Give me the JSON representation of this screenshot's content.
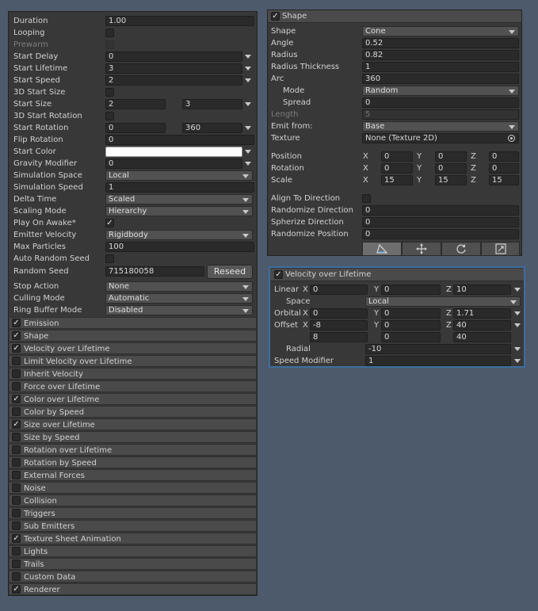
{
  "main": {
    "duration": {
      "label": "Duration",
      "value": "1.00"
    },
    "looping": {
      "label": "Looping"
    },
    "prewarm": {
      "label": "Prewarm"
    },
    "start_delay": {
      "label": "Start Delay",
      "value": "0"
    },
    "start_lifetime": {
      "label": "Start Lifetime",
      "value": "3"
    },
    "start_speed": {
      "label": "Start Speed",
      "value": "2"
    },
    "start_size_3d": {
      "label": "3D Start Size"
    },
    "start_size": {
      "label": "Start Size",
      "min": "2",
      "max": "3"
    },
    "start_rotation_3d": {
      "label": "3D Start Rotation"
    },
    "start_rotation": {
      "label": "Start Rotation",
      "min": "0",
      "max": "360"
    },
    "flip_rotation": {
      "label": "Flip Rotation",
      "value": "0"
    },
    "start_color": {
      "label": "Start Color",
      "color": "#ffffff"
    },
    "gravity_modifier": {
      "label": "Gravity Modifier",
      "value": "0"
    },
    "simulation_space": {
      "label": "Simulation Space",
      "value": "Local"
    },
    "simulation_speed": {
      "label": "Simulation Speed",
      "value": "1"
    },
    "delta_time": {
      "label": "Delta Time",
      "value": "Scaled"
    },
    "scaling_mode": {
      "label": "Scaling Mode",
      "value": "Hierarchy"
    },
    "play_on_awake": {
      "label": "Play On Awake*",
      "checked": "✓"
    },
    "emitter_velocity": {
      "label": "Emitter Velocity",
      "value": "Rigidbody"
    },
    "max_particles": {
      "label": "Max Particles",
      "value": "100"
    },
    "auto_random_seed": {
      "label": "Auto Random Seed"
    },
    "random_seed": {
      "label": "Random Seed",
      "value": "715180058",
      "button": "Reseed"
    },
    "stop_action": {
      "label": "Stop Action",
      "value": "None"
    },
    "culling_mode": {
      "label": "Culling Mode",
      "value": "Automatic"
    },
    "ring_buffer_mode": {
      "label": "Ring Buffer Mode",
      "value": "Disabled"
    }
  },
  "modules": [
    {
      "label": "Emission",
      "check": "✓"
    },
    {
      "label": "Shape",
      "check": "✓"
    },
    {
      "label": "Velocity over Lifetime",
      "check": "✓"
    },
    {
      "label": "Limit Velocity over Lifetime",
      "check": ""
    },
    {
      "label": "Inherit Velocity",
      "check": ""
    },
    {
      "label": "Force over Lifetime",
      "check": ""
    },
    {
      "label": "Color over Lifetime",
      "check": "✓"
    },
    {
      "label": "Color by Speed",
      "check": ""
    },
    {
      "label": "Size over Lifetime",
      "check": "✓"
    },
    {
      "label": "Size by Speed",
      "check": ""
    },
    {
      "label": "Rotation over Lifetime",
      "check": ""
    },
    {
      "label": "Rotation by Speed",
      "check": ""
    },
    {
      "label": "External Forces",
      "check": ""
    },
    {
      "label": "Noise",
      "check": ""
    },
    {
      "label": "Collision",
      "check": ""
    },
    {
      "label": "Triggers",
      "check": ""
    },
    {
      "label": "Sub Emitters",
      "check": ""
    },
    {
      "label": "Texture Sheet Animation",
      "check": "✓"
    },
    {
      "label": "Lights",
      "check": ""
    },
    {
      "label": "Trails",
      "check": ""
    },
    {
      "label": "Custom Data",
      "check": ""
    },
    {
      "label": "Renderer",
      "check": "✓"
    }
  ],
  "shape": {
    "header": "Shape",
    "check": "✓",
    "shape": {
      "label": "Shape",
      "value": "Cone"
    },
    "angle": {
      "label": "Angle",
      "value": "0.52"
    },
    "radius": {
      "label": "Radius",
      "value": "0.82"
    },
    "radius_thickness": {
      "label": "Radius Thickness",
      "value": "1"
    },
    "arc": {
      "label": "Arc",
      "value": "360"
    },
    "mode": {
      "label": "Mode",
      "value": "Random"
    },
    "spread": {
      "label": "Spread",
      "value": "0"
    },
    "length": {
      "label": "Length",
      "value": "5"
    },
    "emit_from": {
      "label": "Emit from:",
      "value": "Base"
    },
    "texture": {
      "label": "Texture",
      "value": "None (Texture 2D)"
    },
    "axes": {
      "x": "X",
      "y": "Y",
      "z": "Z"
    },
    "position": {
      "label": "Position",
      "x": "0",
      "y": "0",
      "z": "0"
    },
    "rotation": {
      "label": "Rotation",
      "x": "0",
      "y": "0",
      "z": "0"
    },
    "scale": {
      "label": "Scale",
      "x": "15",
      "y": "15",
      "z": "15"
    },
    "align_to_direction": {
      "label": "Align To Direction"
    },
    "randomize_direction": {
      "label": "Randomize Direction",
      "value": "0"
    },
    "spherize_direction": {
      "label": "Spherize Direction",
      "value": "0"
    },
    "randomize_position": {
      "label": "Randomize Position",
      "value": "0"
    }
  },
  "velocity": {
    "header": "Velocity over Lifetime",
    "check": "✓",
    "linear": {
      "label": "Linear",
      "x": "0",
      "y": "0",
      "z": "10"
    },
    "space": {
      "label": "Space",
      "value": "Local"
    },
    "orbital": {
      "label": "Orbital",
      "x": "0",
      "y": "0",
      "z": "1.71"
    },
    "offset": {
      "label": "Offset",
      "x": "-8",
      "y": "0",
      "z": "40",
      "x2": "8",
      "y2": "0",
      "z2": "40"
    },
    "radial": {
      "label": "Radial",
      "value": "-10"
    },
    "speed_modifier": {
      "label": "Speed Modifier",
      "value": "1"
    }
  },
  "icons": [
    "checkmark-icon",
    "dropdown-arrow-icon",
    "object-picker-icon",
    "edit-shape-icon",
    "move-icon",
    "rotate-icon",
    "scale-icon"
  ]
}
